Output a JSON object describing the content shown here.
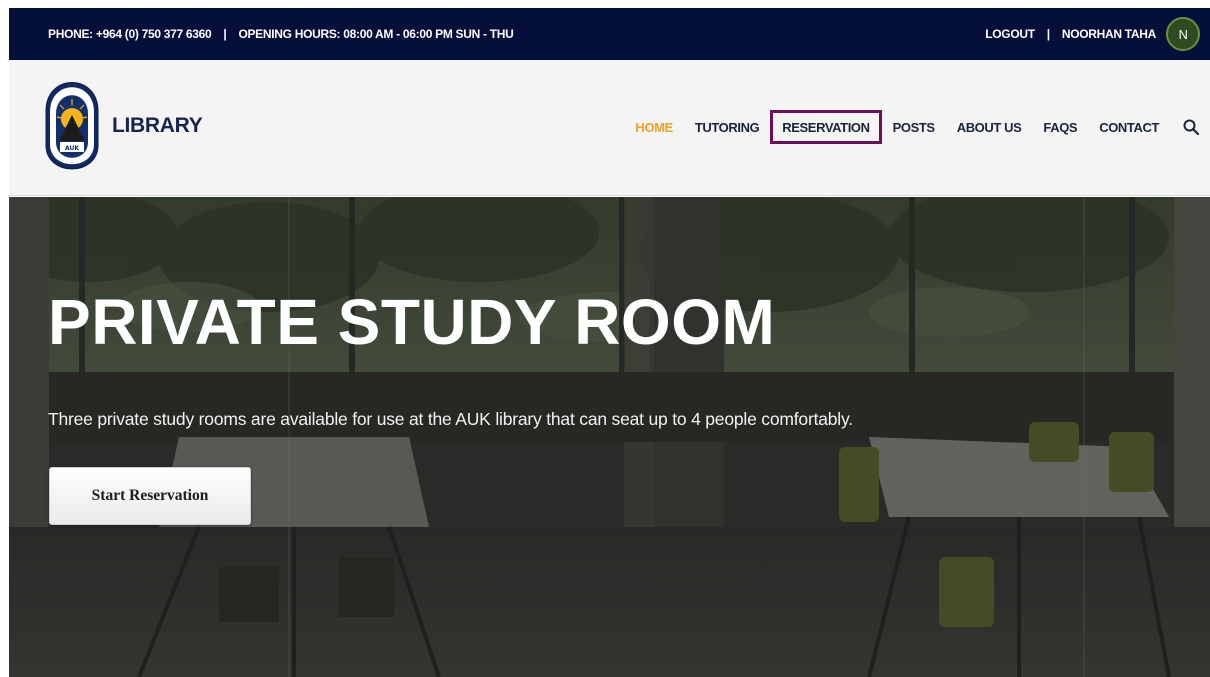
{
  "topbar": {
    "phone": "PHONE: +964 (0) 750 377 6360",
    "separator": "|",
    "hours": "OPENING HOURS: 08:00 AM - 06:00 PM  SUN - THU",
    "logout": "LOGOUT",
    "user_name": "NOORHAN TAHA",
    "avatar_initial": "N"
  },
  "header": {
    "brand": "LIBRARY",
    "seal_text": "THE AMERICAN UNIVERSITY OF KURDISTAN",
    "seal_mark": "AUK",
    "nav": [
      {
        "label": "HOME"
      },
      {
        "label": "TUTORING"
      },
      {
        "label": "RESERVATION"
      },
      {
        "label": "POSTS"
      },
      {
        "label": "ABOUT US"
      },
      {
        "label": "FAQS"
      },
      {
        "label": "CONTACT"
      }
    ],
    "search_icon": "search-icon"
  },
  "hero": {
    "title": "PRIVATE STUDY ROOM",
    "description": "Three private study rooms are available for use at the AUK library that can seat up to 4 people comfortably.",
    "button_label": "Start Reservation"
  },
  "colors": {
    "topbar_bg": "#04103a",
    "nav_active": "#f1a21f",
    "highlight_border": "#6a0f5c",
    "brand_text": "#15244f"
  }
}
